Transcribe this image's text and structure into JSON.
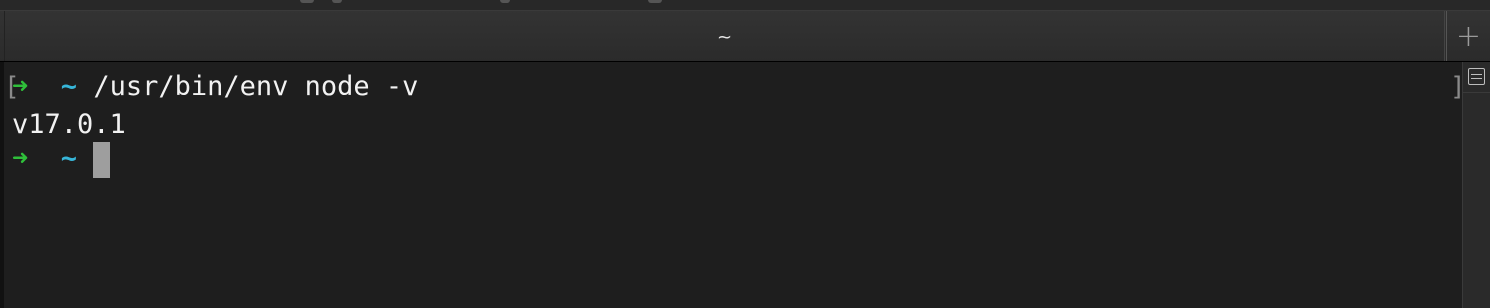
{
  "tab": {
    "title": "~",
    "new_tab_icon": "plus-icon",
    "new_tab_glyph": "+"
  },
  "terminal": {
    "lines": [
      {
        "arrow": "➜",
        "tilde": "~",
        "command": "/usr/bin/env node -v"
      },
      {
        "output": "v17.0.1"
      },
      {
        "arrow": "➜",
        "tilde": "~",
        "command": ""
      }
    ],
    "mark_left": "[",
    "mark_right": "]"
  },
  "scrollbar": {
    "icon": "split-pane-icon"
  },
  "colors": {
    "background": "#1e1e1e",
    "prompt_arrow": "#2fbf3a",
    "prompt_tilde": "#37b6d9",
    "text": "#f2f2f2",
    "cursor": "#9e9e9e"
  }
}
